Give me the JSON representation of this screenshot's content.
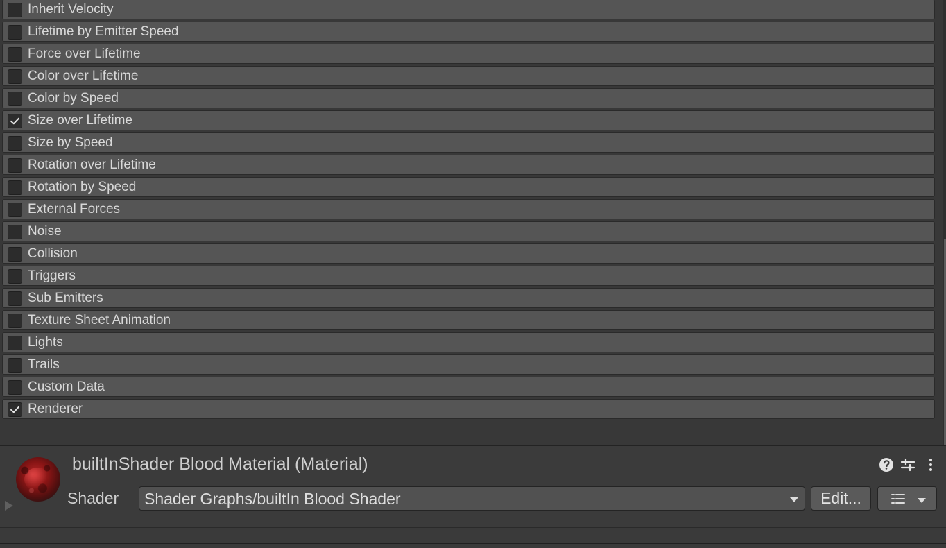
{
  "modules": [
    {
      "label": "Inherit Velocity",
      "checked": false
    },
    {
      "label": "Lifetime by Emitter Speed",
      "checked": false
    },
    {
      "label": "Force over Lifetime",
      "checked": false
    },
    {
      "label": "Color over Lifetime",
      "checked": false
    },
    {
      "label": "Color by Speed",
      "checked": false
    },
    {
      "label": "Size over Lifetime",
      "checked": true
    },
    {
      "label": "Size by Speed",
      "checked": false
    },
    {
      "label": "Rotation over Lifetime",
      "checked": false
    },
    {
      "label": "Rotation by Speed",
      "checked": false
    },
    {
      "label": "External Forces",
      "checked": false
    },
    {
      "label": "Noise",
      "checked": false
    },
    {
      "label": "Collision",
      "checked": false
    },
    {
      "label": "Triggers",
      "checked": false
    },
    {
      "label": "Sub Emitters",
      "checked": false
    },
    {
      "label": "Texture Sheet Animation",
      "checked": false
    },
    {
      "label": "Lights",
      "checked": false
    },
    {
      "label": "Trails",
      "checked": false
    },
    {
      "label": "Custom Data",
      "checked": false
    },
    {
      "label": "Renderer",
      "checked": true
    }
  ],
  "material": {
    "title": "builtInShader Blood Material (Material)",
    "shader_label": "Shader",
    "shader_value": "Shader Graphs/builtIn Blood Shader",
    "edit_label": "Edit...",
    "icons": {
      "help": "help-icon",
      "settings": "settings-icon",
      "menu": "more-vert-icon",
      "list": "list-icon",
      "dropdown": "chevron-down-icon",
      "foldout": "chevron-right-icon"
    }
  },
  "colors": {
    "panel_bg": "#383838",
    "row_bg": "#555555",
    "checkbox_bg": "#2c2c2c",
    "checkmark": "#e6e6e6",
    "material_red": "#8a1515"
  }
}
